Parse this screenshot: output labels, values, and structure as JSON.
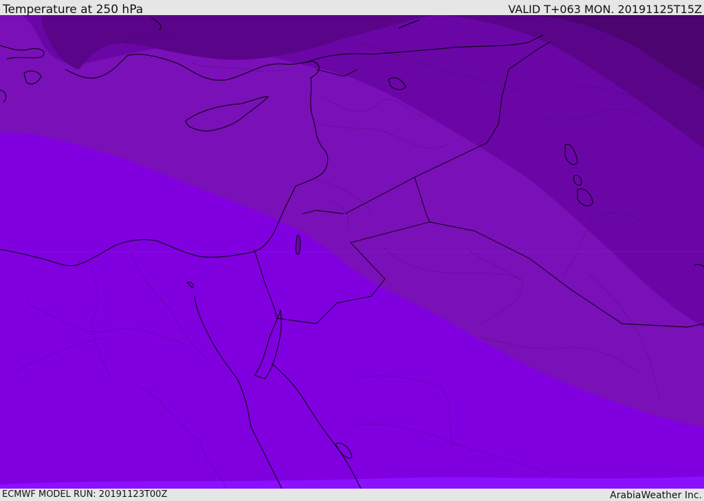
{
  "header": {
    "title": "Temperature at 250 hPa",
    "valid": "VALID T+063 MON. 20191125T15Z"
  },
  "footer": {
    "model_run": "ECMWF MODEL RUN: 20191123T00Z",
    "credit": "ArabiaWeather Inc."
  },
  "colors": {
    "band_coldest": "#4b0470",
    "band_cold": "#5a048a",
    "band_cool": "#6a06a6",
    "band_mid": "#7a10b8",
    "band_warm": "#8000e0",
    "band_warmest": "#8a10ff",
    "background": "#e6e6e6"
  }
}
